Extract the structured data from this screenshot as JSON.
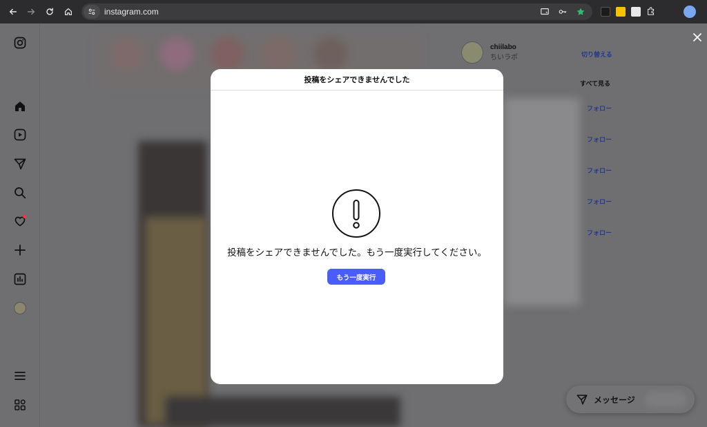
{
  "browser": {
    "url": "instagram.com"
  },
  "sidebar": {
    "icons": [
      "instagram-icon",
      "home-icon",
      "reels-icon",
      "direct-icon",
      "search-icon",
      "notifications-icon",
      "create-icon",
      "insights-icon",
      "profile-avatar",
      "menu-icon",
      "threads-icon"
    ],
    "notification_dot_color": "#ff3040"
  },
  "right_column": {
    "username": "chiilabo",
    "display_name": "ちいラボ",
    "switch_label": "切り替える",
    "see_all_label": "すべて見る",
    "follow_labels": [
      "フォロー",
      "フォロー",
      "フォロー",
      "フォロー",
      "フォロー"
    ]
  },
  "messages": {
    "label": "メッセージ"
  },
  "modal": {
    "title": "投稿をシェアできませんでした",
    "error_message": "投稿をシェアできませんでした。もう一度実行してください。",
    "retry_label": "もう一度実行",
    "accent_color": "#4a5df9"
  }
}
